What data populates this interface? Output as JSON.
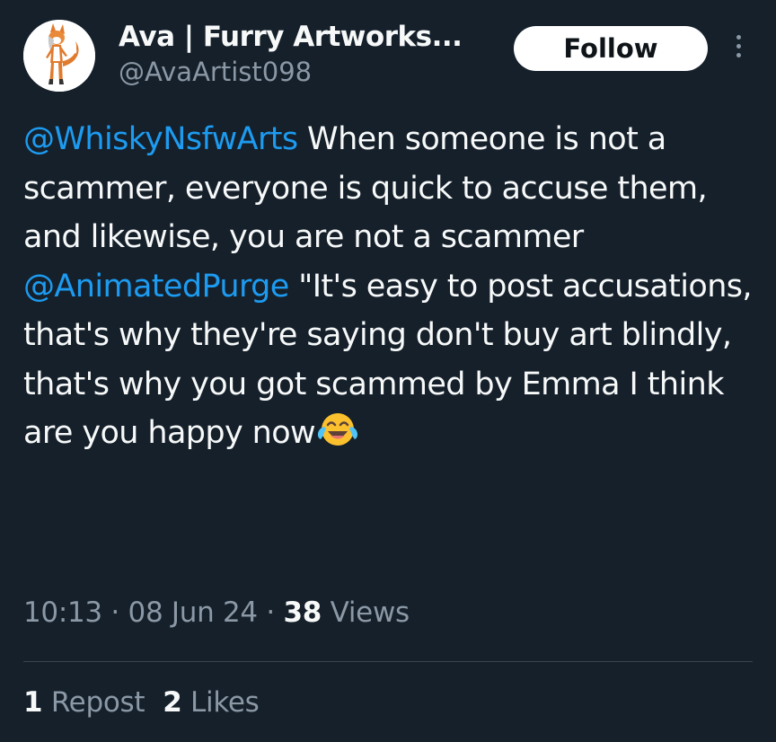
{
  "author": {
    "display_name": "Ava | Furry Artworks...",
    "handle": "@AvaArtist098",
    "avatar_icon": "fox-character-avatar"
  },
  "actions": {
    "follow_label": "Follow",
    "more_icon": "more-vertical-icon"
  },
  "tweet": {
    "mention_1": "@WhiskyNsfwArts",
    "text_1": " When someone is not a scammer, everyone is quick to accuse them, and likewise, you are not a scammer",
    "mention_2": "@AnimatedPurge",
    "text_2": " \"It's easy to post accusations, that's why they're saying don't buy art blindly, that's why you got scammed by Emma I think are you happy now",
    "emoji": "face-with-tears-of-joy"
  },
  "meta": {
    "time": "10:13",
    "sep_1": " · ",
    "date": "08 Jun 24",
    "sep_2": " · ",
    "views_count": "38",
    "views_label": " Views"
  },
  "stats": {
    "reposts_count": "1",
    "reposts_label": " Repost",
    "likes_count": "2",
    "likes_label": " Likes"
  },
  "colors": {
    "background": "#15202b",
    "text": "#f7f9f9",
    "secondary_text": "#8b98a5",
    "link": "#1d9bf0",
    "divider": "#38444d"
  }
}
